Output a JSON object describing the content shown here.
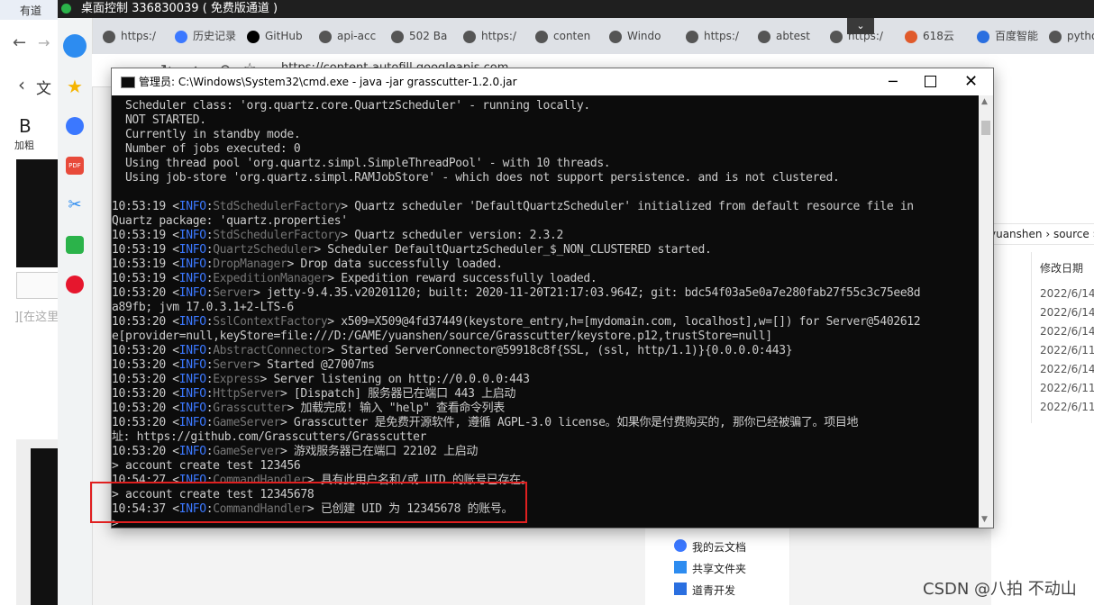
{
  "remote_title": "桌面控制 336830039 ( 免费版通道 )",
  "left_app": {
    "tab_label": "有道",
    "bold_label": "B",
    "bold_text": "加粗",
    "placeholder_text": "][在这里",
    "back_icon": "chevron-left-icon",
    "doc_text": "文"
  },
  "browser": {
    "tabs": [
      {
        "label": "https:/"
      },
      {
        "label": "历史记录"
      },
      {
        "label": "GitHub"
      },
      {
        "label": "api-acc"
      },
      {
        "label": "502 Ba"
      },
      {
        "label": "https:/"
      },
      {
        "label": "conten"
      },
      {
        "label": "Windo"
      },
      {
        "label": "https:/"
      },
      {
        "label": "abtest"
      },
      {
        "label": "https:/"
      },
      {
        "label": "618云"
      },
      {
        "label": "百度智能"
      },
      {
        "label": "pytho"
      }
    ],
    "address": "https://content-autofill.googleapis.com"
  },
  "cmd": {
    "title": "管理员: C:\\Windows\\System32\\cmd.exe - java  -jar grasscutter-1.2.0.jar",
    "lines": [
      {
        "plain": "  Scheduler class: 'org.quartz.core.QuartzScheduler' - running locally."
      },
      {
        "plain": "  NOT STARTED."
      },
      {
        "plain": "  Currently in standby mode."
      },
      {
        "plain": "  Number of jobs executed: 0"
      },
      {
        "plain": "  Using thread pool 'org.quartz.simpl.SimpleThreadPool' - with 10 threads."
      },
      {
        "plain": "  Using job-store 'org.quartz.simpl.RAMJobStore' - which does not support persistence. and is not clustered."
      },
      {
        "plain": ""
      },
      {
        "time": "10:53:19 <",
        "level": "INFO",
        "colon": ":",
        "cls": "StdSchedulerFactory",
        "msg": "> Quartz scheduler 'DefaultQuartzScheduler' initialized from default resource file in"
      },
      {
        "plain": "Quartz package: 'quartz.properties'"
      },
      {
        "time": "10:53:19 <",
        "level": "INFO",
        "colon": ":",
        "cls": "StdSchedulerFactory",
        "msg": "> Quartz scheduler version: 2.3.2"
      },
      {
        "time": "10:53:19 <",
        "level": "INFO",
        "colon": ":",
        "cls": "QuartzScheduler",
        "msg": "> Scheduler DefaultQuartzScheduler_$_NON_CLUSTERED started."
      },
      {
        "time": "10:53:19 <",
        "level": "INFO",
        "colon": ":",
        "cls": "DropManager",
        "msg": "> Drop data successfully loaded."
      },
      {
        "time": "10:53:19 <",
        "level": "INFO",
        "colon": ":",
        "cls": "ExpeditionManager",
        "msg": "> Expedition reward successfully loaded."
      },
      {
        "time": "10:53:20 <",
        "level": "INFO",
        "colon": ":",
        "cls": "Server",
        "msg": "> jetty-9.4.35.v20201120; built: 2020-11-20T21:17:03.964Z; git: bdc54f03a5e0a7e280fab27f55c3c75ee8d"
      },
      {
        "plain": "a89fb; jvm 17.0.3.1+2-LTS-6"
      },
      {
        "time": "10:53:20 <",
        "level": "INFO",
        "colon": ":",
        "cls": "SslContextFactory",
        "msg": "> x509=X509@4fd37449(keystore_entry,h=[mydomain.com, localhost],w=[]) for Server@5402612"
      },
      {
        "plain": "e[provider=null,keyStore=file:///D:/GAME/yuanshen/source/Grasscutter/keystore.p12,trustStore=null]"
      },
      {
        "time": "10:53:20 <",
        "level": "INFO",
        "colon": ":",
        "cls": "AbstractConnector",
        "msg": "> Started ServerConnector@59918c8f{SSL, (ssl, http/1.1)}{0.0.0.0:443}"
      },
      {
        "time": "10:53:20 <",
        "level": "INFO",
        "colon": ":",
        "cls": "Server",
        "msg": "> Started @27007ms"
      },
      {
        "time": "10:53:20 <",
        "level": "INFO",
        "colon": ":",
        "cls": "Express",
        "msg": "> Server listening on http://0.0.0.0:443"
      },
      {
        "time": "10:53:20 <",
        "level": "INFO",
        "colon": ":",
        "cls": "HttpServer",
        "msg": "> [Dispatch] 服务器已在端口 443 上启动"
      },
      {
        "time": "10:53:20 <",
        "level": "INFO",
        "colon": ":",
        "cls": "Grasscutter",
        "msg": "> 加载完成! 输入 \"help\" 查看命令列表"
      },
      {
        "time": "10:53:20 <",
        "level": "INFO",
        "colon": ":",
        "cls": "GameServer",
        "msg": "> Grasscutter 是免费开源软件, 遵循 AGPL-3.0 license。如果你是付费购买的, 那你已经被骗了。项目地"
      },
      {
        "plain": "址: https://github.com/Grasscutters/Grasscutter"
      },
      {
        "time": "10:53:20 <",
        "level": "INFO",
        "colon": ":",
        "cls": "GameServer",
        "msg": "> 游戏服务器已在端口 22102 上启动"
      },
      {
        "plain": "> account create test 123456"
      },
      {
        "time": "10:54:27 <",
        "level": "INFO",
        "colon": ":",
        "cls": "CommandHandler",
        "msg": "> 具有此用户名和/或 UID 的账号已存在。"
      },
      {
        "plain": "> account create test 12345678"
      },
      {
        "time": "10:54:37 <",
        "level": "INFO",
        "colon": ":",
        "cls": "CommandHandler",
        "msg": "> 已创建 UID 为 12345678 的账号。"
      },
      {
        "plain": ">"
      }
    ]
  },
  "explorer": {
    "breadcrumb": "yuanshen  ›  source  ›",
    "column_header": "修改日期",
    "dates": [
      "2022/6/14",
      "2022/6/14",
      "2022/6/14",
      "2022/6/11",
      "2022/6/14",
      "2022/6/11",
      "2022/6/11"
    ],
    "nav_items": [
      {
        "label": "我的云文档"
      },
      {
        "label": "共享文件夹"
      },
      {
        "label": "道青开发"
      }
    ]
  },
  "watermark": "CSDN @八拍 不动山"
}
